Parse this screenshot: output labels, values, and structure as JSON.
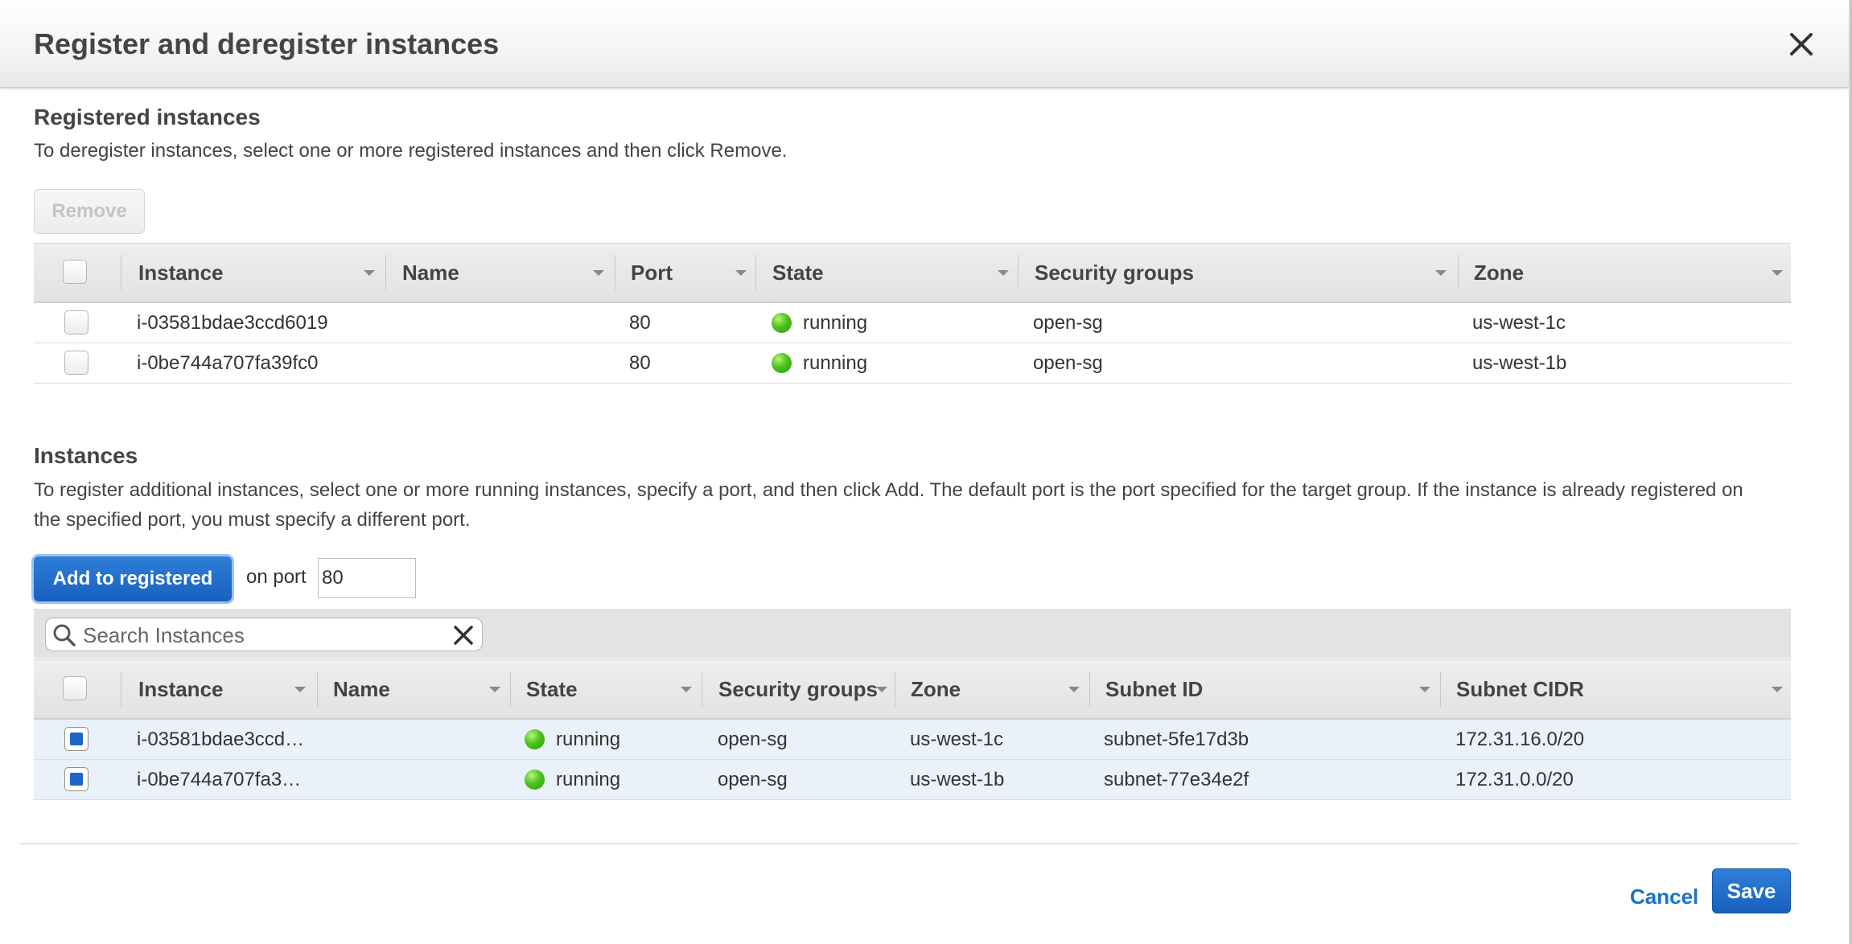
{
  "dialog": {
    "title": "Register and deregister instances"
  },
  "registered": {
    "title": "Registered instances",
    "description": "To deregister instances, select one or more registered instances and then click Remove.",
    "remove_label": "Remove",
    "columns": [
      "Instance",
      "Name",
      "Port",
      "State",
      "Security groups",
      "Zone"
    ],
    "rows": [
      {
        "instance": "i-03581bdae3ccd6019",
        "name": "",
        "port": "80",
        "state": "running",
        "security_groups": "open-sg",
        "zone": "us-west-1c",
        "selected": false
      },
      {
        "instance": "i-0be744a707fa39fc0",
        "name": "",
        "port": "80",
        "state": "running",
        "security_groups": "open-sg",
        "zone": "us-west-1b",
        "selected": false
      }
    ]
  },
  "instances": {
    "title": "Instances",
    "description": "To register additional instances, select one or more running instances, specify a port, and then click Add. The default port is the port specified for the target group. If the instance is already registered on the specified port, you must specify a different port.",
    "add_label": "Add to registered",
    "on_port_label": "on port",
    "port_value": "80",
    "search_placeholder": "Search Instances",
    "columns": [
      "Instance",
      "Name",
      "State",
      "Security groups",
      "Zone",
      "Subnet ID",
      "Subnet CIDR"
    ],
    "rows": [
      {
        "instance": "i-03581bdae3ccd…",
        "name": "",
        "state": "running",
        "security_groups": "open-sg",
        "zone": "us-west-1c",
        "subnet_id": "subnet-5fe17d3b",
        "subnet_cidr": "172.31.16.0/20",
        "selected": true
      },
      {
        "instance": "i-0be744a707fa3…",
        "name": "",
        "state": "running",
        "security_groups": "open-sg",
        "zone": "us-west-1b",
        "subnet_id": "subnet-77e34e2f",
        "subnet_cidr": "172.31.0.0/20",
        "selected": true
      }
    ]
  },
  "footer": {
    "cancel_label": "Cancel",
    "save_label": "Save"
  },
  "colors": {
    "primary_button": "#1f6ccc",
    "link": "#1a73c8",
    "running_status": "#3cb516",
    "selected_row": "#eaf1fa"
  },
  "icons": [
    "close-icon",
    "search-icon",
    "clear-search-icon",
    "sort-arrow-icon",
    "status-running-icon"
  ]
}
